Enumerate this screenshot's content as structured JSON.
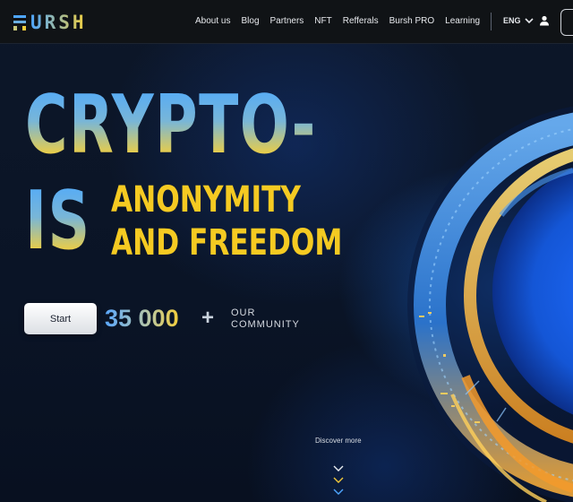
{
  "brand": {
    "logo_text": "URSH"
  },
  "nav": {
    "items": [
      {
        "label": "About us"
      },
      {
        "label": "Blog"
      },
      {
        "label": "Partners"
      },
      {
        "label": "NFT"
      },
      {
        "label": "Refferals"
      },
      {
        "label": "Bursh PRO"
      },
      {
        "label": "Learning"
      }
    ],
    "language": "ENG"
  },
  "hero": {
    "line1": "CRYPTO-",
    "line2": "IS",
    "tagline_1": "ANONYMITY",
    "tagline_2": "AND FREEDOM",
    "start_label": "Start",
    "community_count": "35 000",
    "plus": "+",
    "community_line1": "OUR",
    "community_line2": "COMMUNITY",
    "discover_label": "Discover more"
  },
  "colors": {
    "accent_yellow": "#f5ca22",
    "accent_blue": "#4ca8ff",
    "header_bg": "#101316",
    "page_bg": "#0b1220"
  },
  "icons": [
    "logo-icon",
    "chevron-down-icon",
    "user-icon",
    "scroll-down-chevrons-icon"
  ]
}
